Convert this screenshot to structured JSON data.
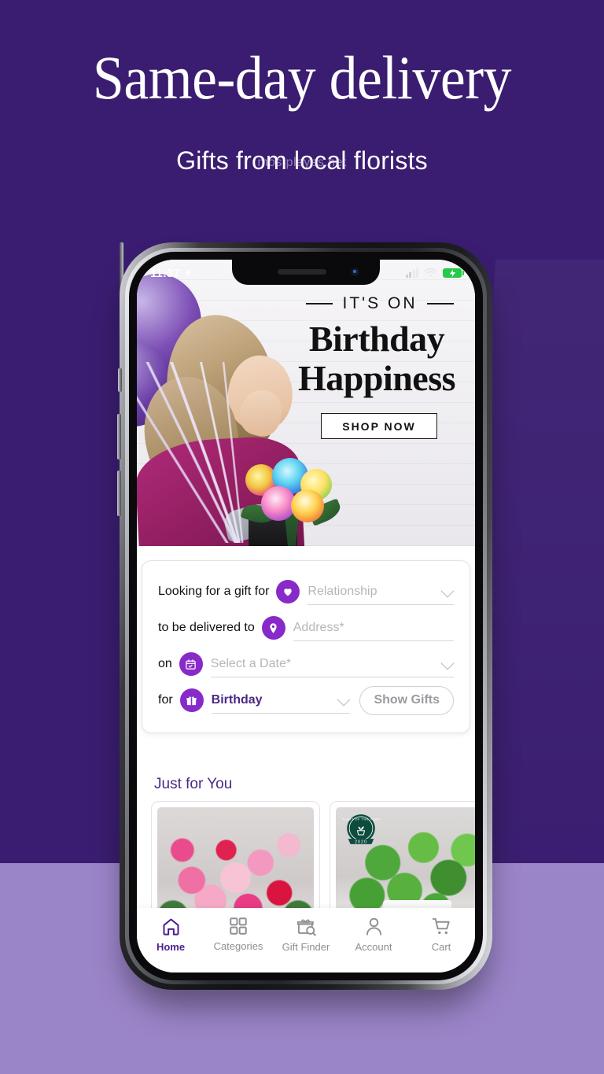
{
  "promo": {
    "headline": "Same-day delivery",
    "subheadline": "Gifts from local florists",
    "watermark": "mos.playes.net",
    "background_dark": "#3a1d70",
    "background_light": "#9b85c9"
  },
  "phone": {
    "status_bar": {
      "time": "11:37",
      "location_icon": "location-arrow-icon",
      "signal_icon": "signal-bars-icon",
      "wifi_icon": "wifi-icon",
      "battery_icon": "battery-charging-icon",
      "battery_color": "#27c94a"
    },
    "hero": {
      "kicker": "IT'S ON",
      "title_line1": "Birthday",
      "title_line2": "Happiness",
      "cta_label": "SHOP NOW"
    },
    "gift_finder": {
      "accent_color": "#8829c9",
      "rows": [
        {
          "label": "Looking for a gift for",
          "icon": "heart-icon",
          "value": "Relationship",
          "filled": false,
          "has_chevron": true
        },
        {
          "label": "to be delivered to",
          "icon": "location-pin-icon",
          "value": "Address*",
          "filled": false,
          "has_chevron": false
        },
        {
          "label": "on",
          "icon": "calendar-icon",
          "value": "Select a Date*",
          "filled": false,
          "has_chevron": true
        },
        {
          "label": "for",
          "icon": "gift-icon",
          "value": "Birthday",
          "filled": true,
          "has_chevron": true
        }
      ],
      "submit_label": "Show Gifts"
    },
    "just_for_you": {
      "title": "Just for You",
      "cards": [
        {
          "name": "flower-bouquet-card",
          "badge": null
        },
        {
          "name": "plant-card",
          "badge": {
            "line1": "PLANT OF THE YEAR",
            "line2": "2020"
          }
        }
      ]
    },
    "bottom_nav": {
      "active": "Home",
      "active_color": "#4b1d8f",
      "items": [
        {
          "label": "Home",
          "icon": "home-icon"
        },
        {
          "label": "Categories",
          "icon": "grid-icon"
        },
        {
          "label": "Gift Finder",
          "icon": "gift-search-icon"
        },
        {
          "label": "Account",
          "icon": "person-icon"
        },
        {
          "label": "Cart",
          "icon": "cart-icon"
        }
      ]
    }
  }
}
